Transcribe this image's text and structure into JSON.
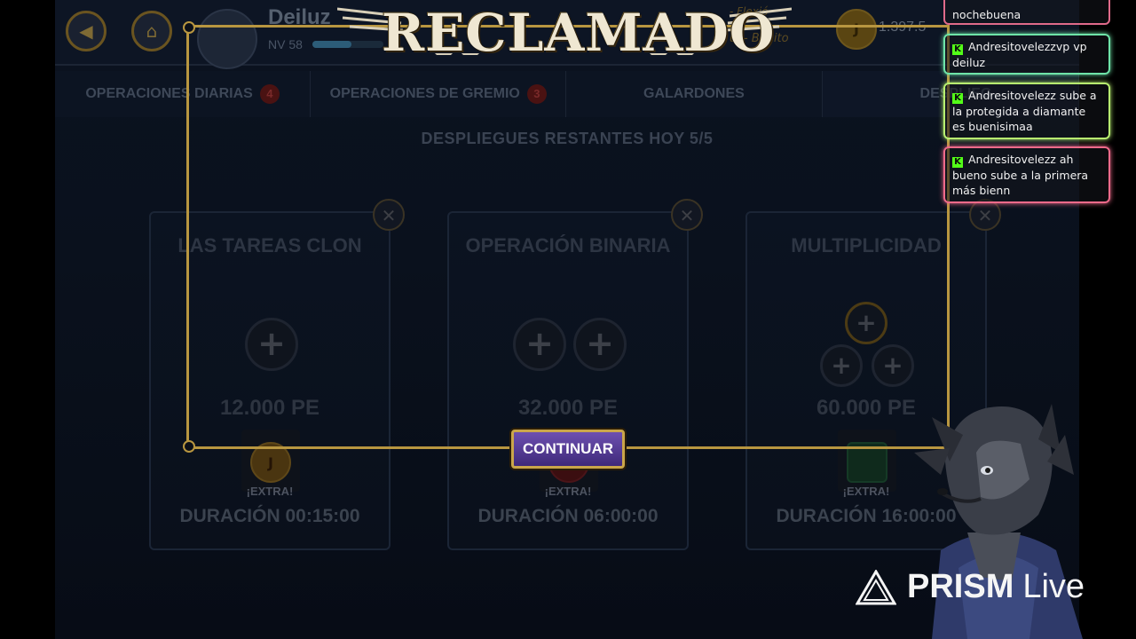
{
  "header": {
    "back_icon": "arrow-left-icon",
    "home_icon": "home-icon",
    "username": "Deiluz",
    "level": "NV 58",
    "xp_fraction": 0.55,
    "currency_value": "1.397.5",
    "currency_symbol": "J",
    "right_text_top": "- Flexió",
    "right_text_bottom": "ul - Bonito"
  },
  "tabs": [
    {
      "label": "OPERACIONES DIARIAS",
      "badge": "4"
    },
    {
      "label": "OPERACIONES DE GREMIO",
      "badge": "3"
    },
    {
      "label": "GALARDONES",
      "badge": ""
    },
    {
      "label": "DESPLIEG",
      "badge": ""
    }
  ],
  "remaining": "DESPLIEGUES RESTANTES HOY 5/5",
  "cards": [
    {
      "title": "LAS TAREAS CLON",
      "cost": "12.000 PE",
      "reward_symbol": "J",
      "extra": "¡EXTRA!",
      "duration": "DURACIÓN 00:15:00"
    },
    {
      "title": "OPERACIÓN BINARIA",
      "cost": "32.000 PE",
      "reward_symbol": "",
      "extra": "¡EXTRA!",
      "duration": "DURACIÓN 06:00:00"
    },
    {
      "title": "MULTIPLICIDAD",
      "cost": "60.000 PE",
      "reward_symbol": "",
      "extra": "¡EXTRA!",
      "duration": "DURACIÓN 16:00:00"
    }
  ],
  "overlay": {
    "banner": "RECLAMADO",
    "continue_label": "CONTINUAR"
  },
  "chat": [
    {
      "user": "",
      "text": "nochebuena"
    },
    {
      "user": "Andresitovelezzvp",
      "text": "vp deiluz"
    },
    {
      "user": "Andresitovelezz",
      "text": "sube a la protegida a diamante es buenisimaa"
    },
    {
      "user": "Andresitovelezz",
      "text": "ah bueno sube a la primera más bienn"
    }
  ],
  "watermark": {
    "brand": "PRISM",
    "suffix": "Live"
  },
  "colors": {
    "gold": "#b89640",
    "button_purple": "#5a3d9a",
    "chat_green": "#6ee4a8",
    "chat_lime": "#b8f070",
    "chat_pink": "#f06a8a"
  }
}
